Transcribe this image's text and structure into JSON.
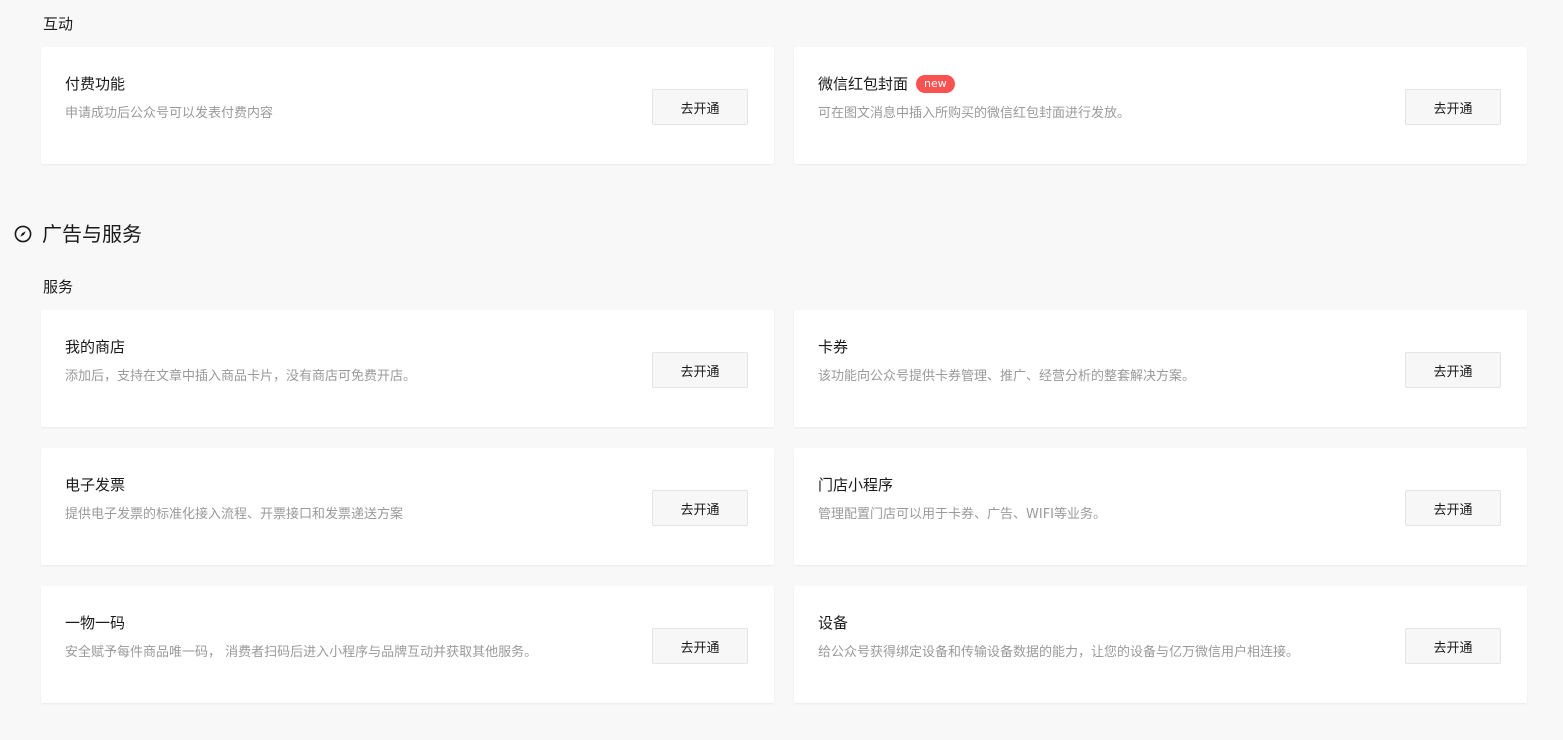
{
  "interaction": {
    "title": "互动",
    "cards": [
      {
        "title": "付费功能",
        "desc": "申请成功后公众号可以发表付费内容",
        "button": "去开通"
      },
      {
        "title": "微信红包封面",
        "badge": "new",
        "desc": "可在图文消息中插入所购买的微信红包封面进行发放。",
        "button": "去开通"
      }
    ]
  },
  "ads_services": {
    "title": "广告与服务",
    "icon": "compass-icon",
    "services": {
      "title": "服务",
      "cards": [
        {
          "title": "我的商店",
          "desc": "添加后，支持在文章中插入商品卡片，没有商店可免费开店。",
          "button": "去开通"
        },
        {
          "title": "卡券",
          "desc": "该功能向公众号提供卡券管理、推广、经营分析的整套解决方案。",
          "button": "去开通"
        },
        {
          "title": "电子发票",
          "desc": "提供电子发票的标准化接入流程、开票接口和发票递送方案",
          "button": "去开通"
        },
        {
          "title": "门店小程序",
          "desc": "管理配置门店可以用于卡券、广告、WIFI等业务。",
          "button": "去开通"
        },
        {
          "title": "一物一码",
          "desc": "安全赋予每件商品唯一码， 消费者扫码后进入小程序与品牌互动并获取其他服务。",
          "button": "去开通"
        },
        {
          "title": "设备",
          "desc": "给公众号获得绑定设备和传输设备数据的能力，让您的设备与亿万微信用户相连接。",
          "button": "去开通"
        }
      ]
    }
  },
  "colors": {
    "badge": "#fa5151",
    "page_bg": "#f8f8f8",
    "card_bg": "#ffffff",
    "desc_text": "#9a9a9a"
  }
}
